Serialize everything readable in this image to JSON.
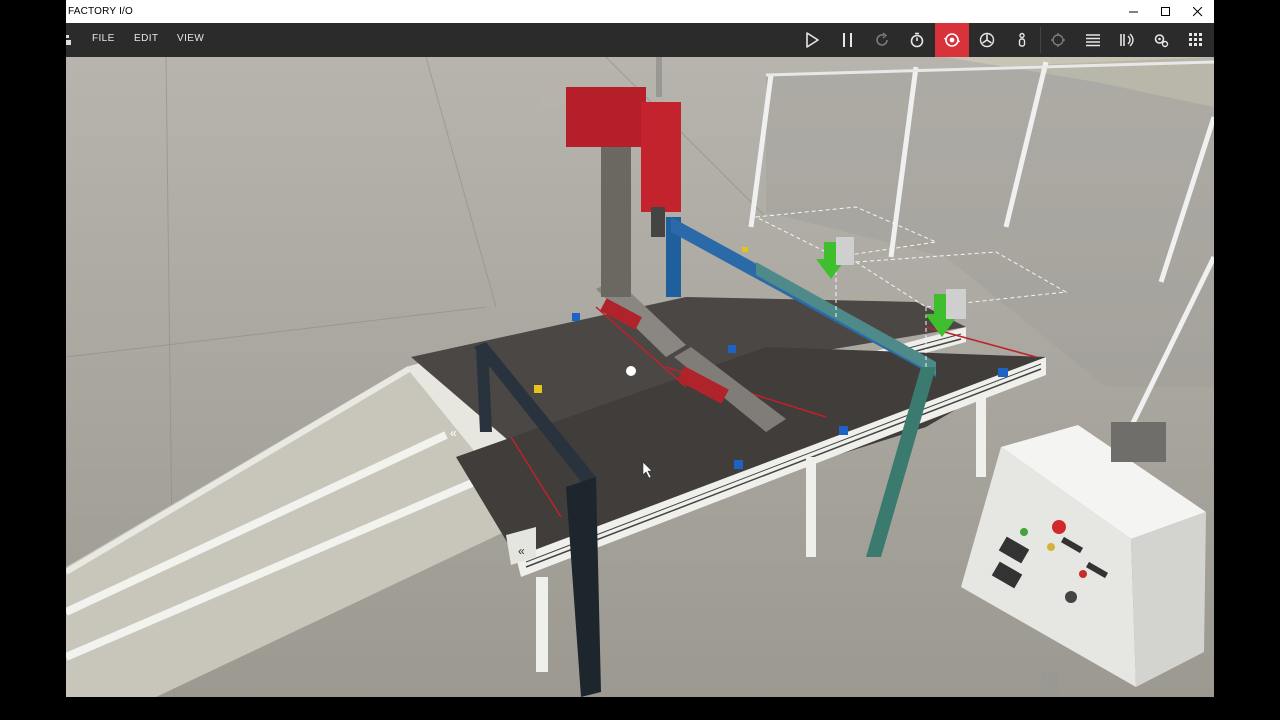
{
  "window": {
    "title": "FACTORY I/O",
    "controls": [
      "minimize",
      "maximize",
      "close"
    ]
  },
  "menu": {
    "items": [
      {
        "label": "FILE"
      },
      {
        "label": "EDIT"
      },
      {
        "label": "VIEW"
      }
    ]
  },
  "toolbar": {
    "buttons": [
      {
        "icon": "play-icon"
      },
      {
        "icon": "pause-icon"
      },
      {
        "icon": "reset-icon"
      },
      {
        "icon": "stopwatch-icon"
      },
      {
        "icon": "camera-orbit-icon",
        "active": true
      },
      {
        "icon": "fan-icon"
      },
      {
        "icon": "first-person-icon"
      },
      {
        "icon": "target-icon"
      },
      {
        "icon": "list-icon"
      },
      {
        "icon": "sensor-icon"
      },
      {
        "icon": "drivers-icon"
      },
      {
        "icon": "palette-icon"
      }
    ],
    "active_color": "#d8323a"
  },
  "scene": {
    "conveyor_arrow_1": "«",
    "conveyor_arrow_2": "«"
  }
}
